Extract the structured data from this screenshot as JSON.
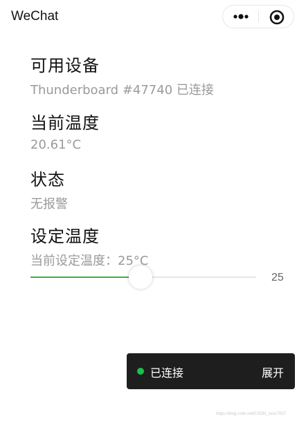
{
  "nav": {
    "title": "WeChat",
    "more_icon": "more-dots-icon",
    "close_icon": "close-circle-icon"
  },
  "sections": {
    "device": {
      "heading": "可用设备",
      "value": "Thunderboard #47740 已连接"
    },
    "temperature": {
      "heading": "当前温度",
      "value": "20.61°C"
    },
    "status": {
      "heading": "状态",
      "value": "无报警"
    },
    "setpoint": {
      "heading": "设定温度",
      "value": "当前设定温度：25°C"
    }
  },
  "slider": {
    "value": 25,
    "value_label": "25",
    "fill_fraction": 0.46,
    "active_color": "#3cb043"
  },
  "toast": {
    "status_label": "已连接",
    "expand_label": "展开",
    "dot_color": "#17c14b"
  },
  "watermark": "https://blog.csdn.net/CSDN_xxxx7007"
}
